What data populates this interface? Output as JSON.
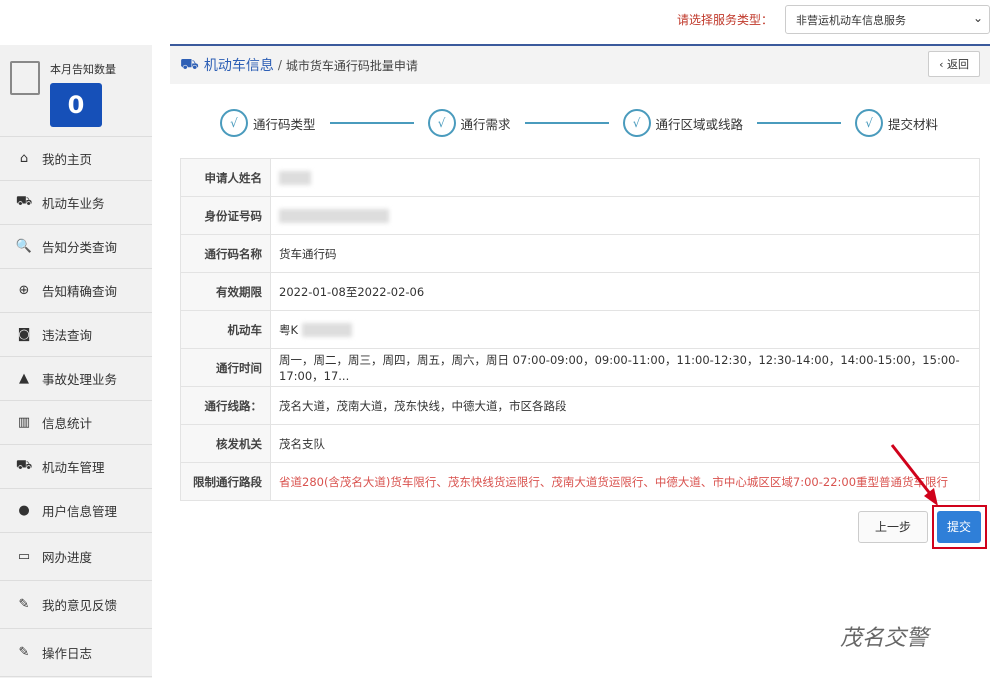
{
  "top": {
    "service_label": "请选择服务类型：",
    "service_value": "非营运机动车信息服务"
  },
  "sidebar": {
    "stat_label": "本月告知数量",
    "stat_value": "0",
    "items": [
      {
        "label": "我的主页",
        "icon": "home-icon",
        "glyph": "⌂"
      },
      {
        "label": "机动车业务",
        "icon": "truck-icon",
        "glyph": "⛟"
      },
      {
        "label": "告知分类查询",
        "icon": "search-icon",
        "glyph": "🔍"
      },
      {
        "label": "告知精确查询",
        "icon": "zoom-in-icon",
        "glyph": "⊕"
      },
      {
        "label": "违法查询",
        "icon": "camera-icon",
        "glyph": "◙"
      },
      {
        "label": "事故处理业务",
        "icon": "warning-icon",
        "glyph": "▲"
      },
      {
        "label": "信息统计",
        "icon": "bar-chart-icon",
        "glyph": "▥"
      },
      {
        "label": "机动车管理",
        "icon": "truck-icon",
        "glyph": "⛟"
      },
      {
        "label": "用户信息管理",
        "icon": "user-icon",
        "glyph": "●"
      },
      {
        "label": "网办进度",
        "icon": "progress-icon",
        "glyph": "▭"
      },
      {
        "label": "我的意见反馈",
        "icon": "feedback-icon",
        "glyph": "✎"
      },
      {
        "label": "操作日志",
        "icon": "log-icon",
        "glyph": "✎"
      }
    ]
  },
  "breadcrumb": {
    "section": "机动车信息",
    "sep": "/",
    "page": "城市货车通行码批量申请",
    "back": "‹ 返回"
  },
  "steps": [
    {
      "mark": "√",
      "label": "通行码类型"
    },
    {
      "mark": "√",
      "label": "通行需求"
    },
    {
      "mark": "√",
      "label": "通行区域或线路"
    },
    {
      "mark": "√",
      "label": "提交材料"
    }
  ],
  "rows": [
    {
      "k": "申请人姓名",
      "v": ""
    },
    {
      "k": "身份证号码",
      "v": ""
    },
    {
      "k": "通行码名称",
      "v": "货车通行码"
    },
    {
      "k": "有效期限",
      "v": "2022-01-08至2022-02-06"
    },
    {
      "k": "机动车",
      "v": "粤K"
    },
    {
      "k": "通行时间",
      "v": "周一，周二，周三，周四，周五，周六，周日 07:00-09:00，09:00-11:00，11:00-12:30，12:30-14:00，14:00-15:00，15:00-17:00，17..."
    },
    {
      "k": "通行线路：",
      "v": "茂名大道，茂南大道，茂东快线，中德大道，市区各路段"
    },
    {
      "k": "核发机关",
      "v": "茂名支队"
    },
    {
      "k": "限制通行路段",
      "v": "省道280(含茂名大道)货车限行、茂东快线货运限行、茂南大道货运限行、中德大道、市中心城区区域7:00-22:00重型普通货车限行"
    }
  ],
  "buttons": {
    "prev": "上一步",
    "submit": "提交"
  },
  "watermark": "茂名交警"
}
